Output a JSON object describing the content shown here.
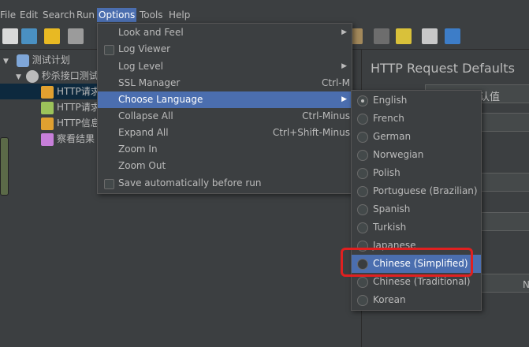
{
  "menubar": [
    "File",
    "Edit",
    "Search",
    "Run",
    "Options",
    "Tools",
    "Help"
  ],
  "tree": [
    {
      "label": "测试计划"
    },
    {
      "label": "秒杀接口测试"
    },
    {
      "label": "HTTP请求"
    },
    {
      "label": "HTTP请求"
    },
    {
      "label": "HTTP信息头"
    },
    {
      "label": "察看结果"
    }
  ],
  "options_menu": [
    {
      "label": "Look and Feel",
      "shortcut": "",
      "submenu": true
    },
    {
      "label": "Log Viewer",
      "shortcut": "",
      "checkbox": true
    },
    {
      "label": "Log Level",
      "shortcut": "",
      "submenu": true
    },
    {
      "label": "SSL Manager",
      "shortcut": "Ctrl-M"
    },
    {
      "label": "Choose Language",
      "shortcut": "",
      "submenu": true
    },
    {
      "label": "Collapse All",
      "shortcut": "Ctrl-Minus"
    },
    {
      "label": "Expand All",
      "shortcut": "Ctrl+Shift-Minus"
    },
    {
      "label": "Zoom In",
      "shortcut": ""
    },
    {
      "label": "Zoom Out",
      "shortcut": ""
    },
    {
      "label": "Save automatically before run",
      "shortcut": "",
      "checkbox": true
    }
  ],
  "language_menu": [
    "English",
    "French",
    "German",
    "Norwegian",
    "Polish",
    "Portuguese (Brazilian)",
    "Spanish",
    "Turkish",
    "Japanese",
    "Chinese (Simplified)",
    "Chinese (Traditional)",
    "Korean"
  ],
  "language_selected": "English",
  "right_panel": {
    "title": "HTTP Request Defaults",
    "field_text": "认值",
    "side_text": "N"
  },
  "colors": {
    "background": "#3c3f41",
    "highlight": "#4b6eaf",
    "annotation": "#e02020"
  }
}
